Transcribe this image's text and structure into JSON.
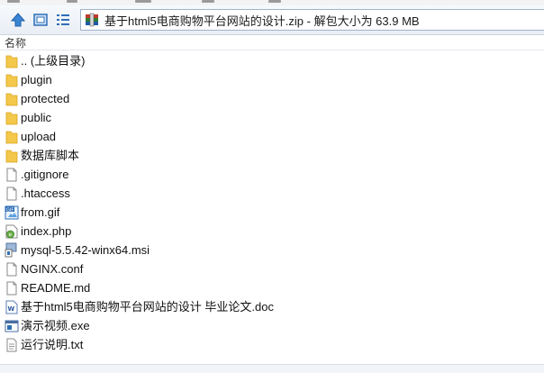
{
  "toolbar": {
    "path": "基于html5电商购物平台网站的设计.zip - 解包大小为 63.9 MB"
  },
  "columns": {
    "name": "名称"
  },
  "files": [
    {
      "name": ".. (上级目录)",
      "icon": "folder-icon"
    },
    {
      "name": "plugin",
      "icon": "folder-icon"
    },
    {
      "name": "protected",
      "icon": "folder-icon"
    },
    {
      "name": "public",
      "icon": "folder-icon"
    },
    {
      "name": "upload",
      "icon": "folder-icon"
    },
    {
      "name": "数据库脚本",
      "icon": "folder-icon"
    },
    {
      "name": ".gitignore",
      "icon": "file-icon"
    },
    {
      "name": ".htaccess",
      "icon": "file-icon"
    },
    {
      "name": "from.gif",
      "icon": "gif-image-icon"
    },
    {
      "name": "index.php",
      "icon": "php-file-icon"
    },
    {
      "name": "mysql-5.5.42-winx64.msi",
      "icon": "installer-icon"
    },
    {
      "name": "NGINX.conf",
      "icon": "file-icon"
    },
    {
      "name": "README.md",
      "icon": "file-icon"
    },
    {
      "name": "基于html5电商购物平台网站的设计 毕业论文.doc",
      "icon": "word-document-icon"
    },
    {
      "name": "演示视频.exe",
      "icon": "executable-icon"
    },
    {
      "name": "运行说明.txt",
      "icon": "text-file-icon"
    }
  ],
  "colors": {
    "folder": "#f4c84a",
    "accent": "#2f6fb5",
    "toolbar_border": "#c9d3df"
  }
}
